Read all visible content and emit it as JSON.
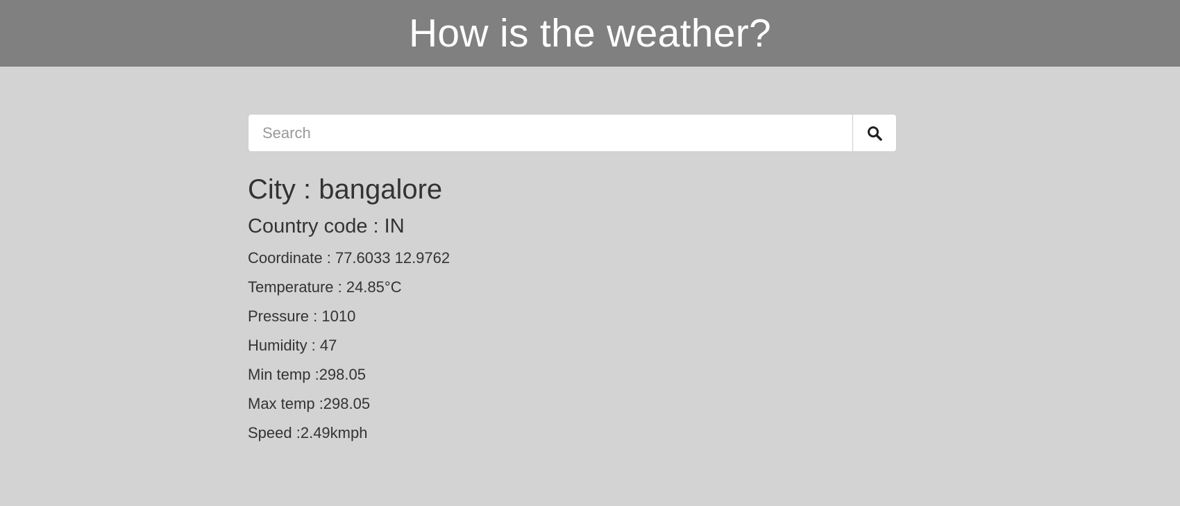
{
  "header": {
    "title": "How is the weather?"
  },
  "search": {
    "placeholder": "Search",
    "value": "",
    "button_icon": "search-icon"
  },
  "weather": {
    "city_label": "City : bangalore",
    "country_label": "Country code : IN",
    "details": [
      "Coordinate : 77.6033 12.9762",
      "Temperature : 24.85°C",
      "Pressure : 1010",
      "Humidity : 47",
      "Min temp :298.05",
      "Max temp :298.05",
      "Speed :2.49kmph"
    ]
  },
  "colors": {
    "header_bg": "#808080",
    "page_bg": "#d3d3d3",
    "text": "#333333"
  }
}
